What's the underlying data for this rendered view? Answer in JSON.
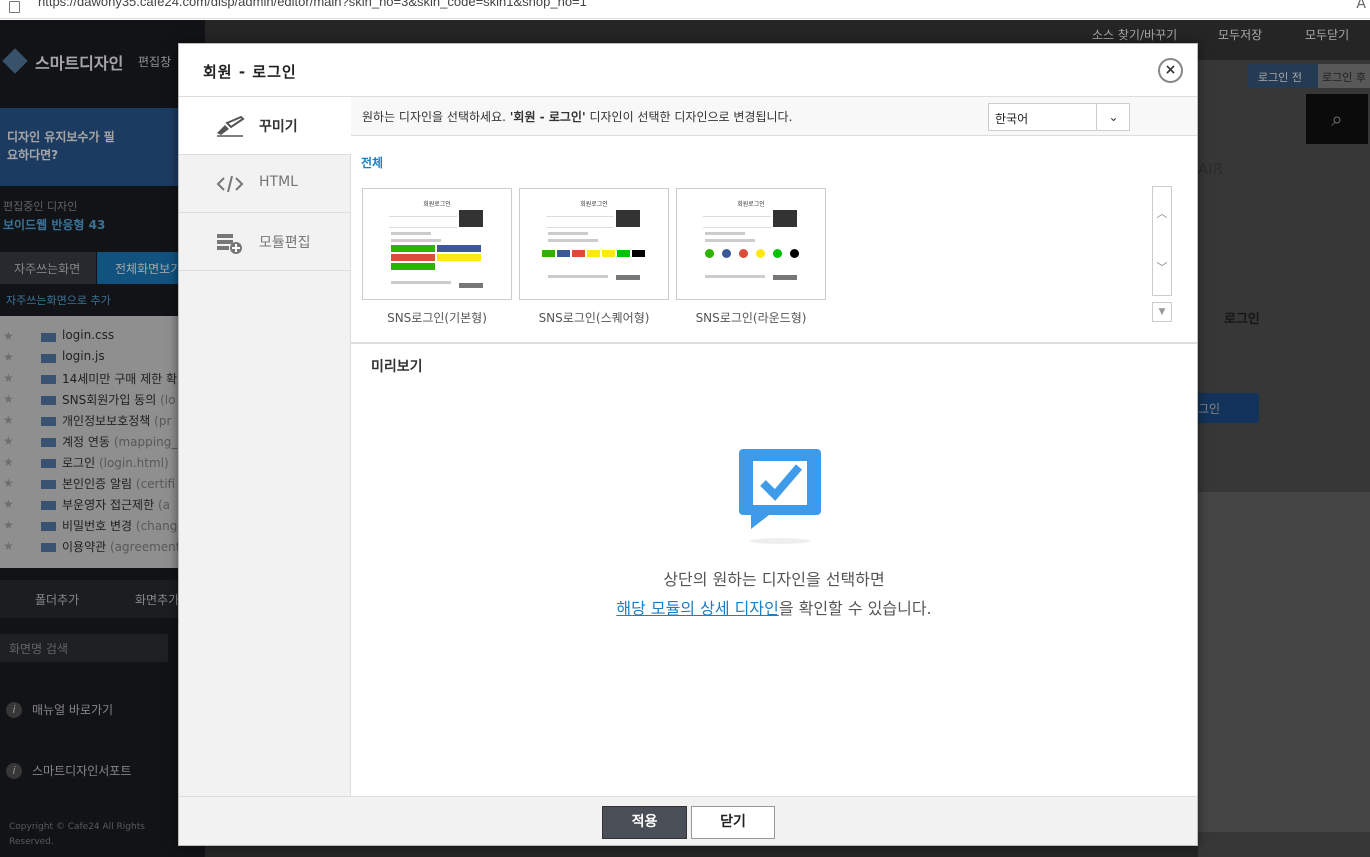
{
  "browser": {
    "url": "https://dawony35.cafe24.com/disp/admin/editor/main?skin_no=3&skin_code=skin1&shop_no=1",
    "right_glyph": "A"
  },
  "background": {
    "brand": "스마트디자인",
    "brand_sub": "편집창",
    "banner_text": "디자인 유지보수가 필요하다면?",
    "editing_label": "편집중인 디자인",
    "editing_value": "보이드웹 반응형 43",
    "tabs": [
      "자주쓰는화면",
      "전체화면보기"
    ],
    "fav_add": "자주쓰는화면으로 추가",
    "files": [
      {
        "name": "login.css",
        "sub": ""
      },
      {
        "name": "login.js",
        "sub": ""
      },
      {
        "name": "14세미만 구매 제한 확",
        "sub": ""
      },
      {
        "name": "SNS회원가입 동의",
        "sub": "(lo"
      },
      {
        "name": "개인정보보호정책",
        "sub": "(pr"
      },
      {
        "name": "계정 연동",
        "sub": "(mapping_"
      },
      {
        "name": "로그인",
        "sub": "(login.html)"
      },
      {
        "name": "본인인증 알림",
        "sub": "(certifi"
      },
      {
        "name": "부운영자 접근제한",
        "sub": "(a"
      },
      {
        "name": "비밀번호 변경",
        "sub": "(chang"
      },
      {
        "name": "이용약관",
        "sub": "(agreement"
      }
    ],
    "add_folder": "폴더추가",
    "add_screen": "화면추가",
    "search_placeholder": "화면명 검색",
    "manual_link": "매뉴얼 바로가기",
    "support_link": "스마트디자인서포트",
    "copyright": "Copyright © Cafe24 All Rights Reserved.",
    "top_actions": [
      "소스 찾기/바꾸기",
      "모두저장",
      "모두닫기"
    ],
    "state_buttons": [
      "로그인 전",
      "로그인 후"
    ],
    "air_text": "AIR",
    "login_text": "로그인",
    "login_btn": "그인"
  },
  "modal": {
    "title": "회원 - 로그인",
    "close_glyph": "×",
    "sidebar": [
      {
        "label": "꾸미기",
        "icon": "brush-icon",
        "active": true
      },
      {
        "label": "HTML",
        "icon": "code-icon",
        "active": false
      },
      {
        "label": "모듈편집",
        "icon": "module-add-icon",
        "active": false
      }
    ],
    "description_pre": "원하는 디자인을 선택하세요. ",
    "description_bold": "'회원 - 로그인'",
    "description_post": " 디자인이 선택한 디자인으로 변경됩니다.",
    "language": {
      "selected": "한국어"
    },
    "category_all": "전체",
    "thumbnails": [
      {
        "label": "SNS로그인(기본형)",
        "thumb_title": "회원로그인"
      },
      {
        "label": "SNS로그인(스퀘어형)",
        "thumb_title": "회원로그인"
      },
      {
        "label": "SNS로그인(라운드형)",
        "thumb_title": "회원로그인"
      }
    ],
    "preview_title": "미리보기",
    "preview_line1": "상단의 원하는 디자인을 선택하면",
    "preview_highlight": "해당 모듈의 상세 디자인",
    "preview_line2_post": "을 확인할 수 있습니다.",
    "apply_label": "적용",
    "close_label": "닫기"
  },
  "colors": {
    "accent": "#1b7fc4",
    "preview_icon": "#3d9be9",
    "apply_bg": "#4a4f57"
  }
}
